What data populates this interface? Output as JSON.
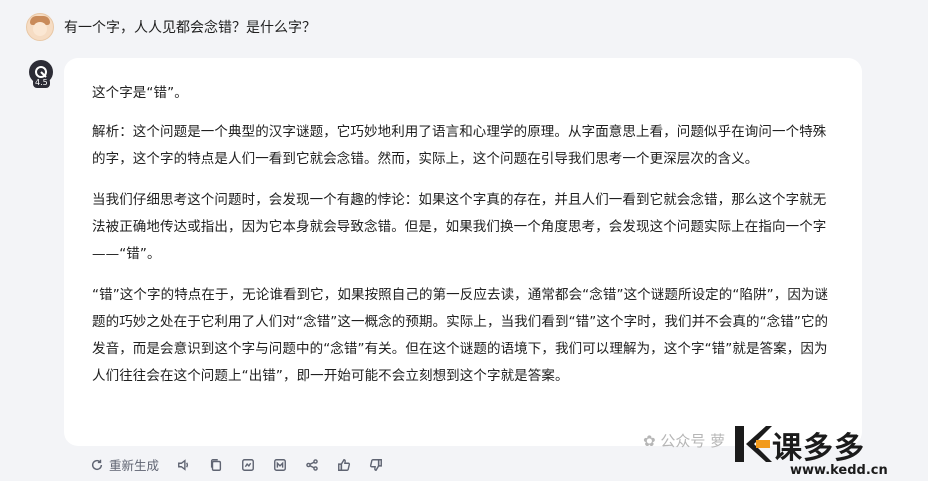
{
  "question": "有一个字，人人见都会念错？是什么字？",
  "bot": {
    "version_badge": "4.5"
  },
  "answer": {
    "paragraphs": [
      "这个字是“错”。",
      "解析：这个问题是一个典型的汉字谜题，它巧妙地利用了语言和心理学的原理。从字面意思上看，问题似乎在询问一个特殊的字，这个字的特点是人们一看到它就会念错。然而，实际上，这个问题在引导我们思考一个更深层次的含义。",
      "当我们仔细思考这个问题时，会发现一个有趣的悖论：如果这个字真的存在，并且人们一看到它就会念错，那么这个字就无法被正确地传达或指出，因为它本身就会导致念错。但是，如果我们换一个角度思考，会发现这个问题实际上在指向一个字——“错”。",
      "“错”这个字的特点在于，无论谁看到它，如果按照自己的第一反应去读，通常都会“念错”这个谜题所设定的“陷阱”，因为谜题的巧妙之处在于它利用了人们对“念错”这一概念的预期。实际上，当我们看到“错”这个字时，我们并不会真的“念错”它的发音，而是会意识到这个字与问题中的“念错”有关。但在这个谜题的语境下，我们可以理解为，这个字“错”就是答案，因为人们往往会在这个问题上“出错”，即一开始可能不会立刻想到这个字就是答案。"
    ]
  },
  "toolbar": {
    "regenerate_label": "重新生成",
    "icons": [
      "refresh-icon",
      "speaker-icon",
      "copy-icon",
      "share-image-icon",
      "mindmap-icon",
      "share-icon",
      "thumbs-up-icon",
      "thumbs-down-icon"
    ]
  },
  "watermark": {
    "text": "公众号",
    "partial": "萝"
  },
  "logo": {
    "brand": "课多多",
    "url": "www.kedd.cn"
  }
}
